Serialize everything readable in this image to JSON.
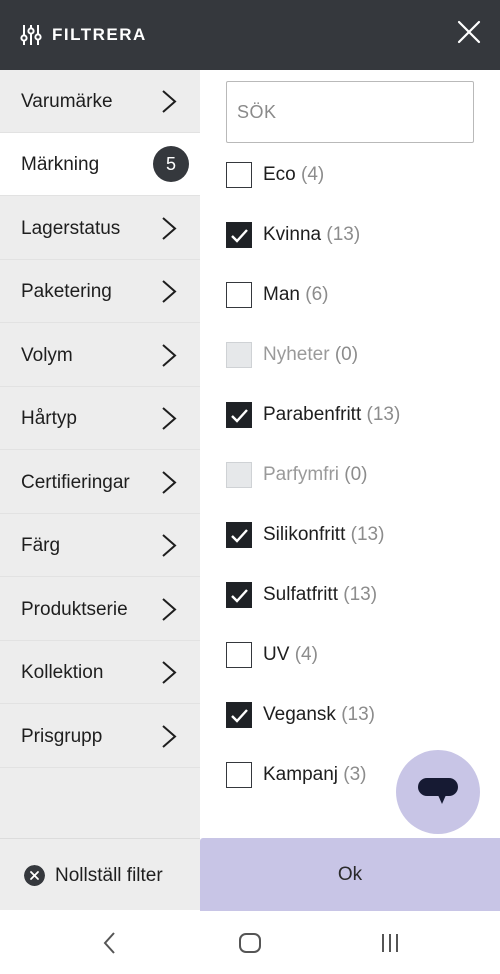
{
  "header": {
    "title": "FILTRERA",
    "filter_icon": "sliders-icon",
    "close_icon": "close-icon"
  },
  "sidebar": {
    "items": [
      {
        "label": "Varumärke"
      },
      {
        "label": "Märkning",
        "badge": "5",
        "active": true
      },
      {
        "label": "Lagerstatus"
      },
      {
        "label": "Paketering"
      },
      {
        "label": "Volym"
      },
      {
        "label": "Hårtyp"
      },
      {
        "label": "Certifieringar"
      },
      {
        "label": "Färg"
      },
      {
        "label": "Produktserie"
      },
      {
        "label": "Kollektion"
      },
      {
        "label": "Prisgrupp"
      }
    ],
    "reset_label": "Nollställ filter"
  },
  "search": {
    "placeholder": "SÖK"
  },
  "options": [
    {
      "name": "Eco",
      "count": "(4)",
      "state": "unchecked"
    },
    {
      "name": "Kvinna",
      "count": "(13)",
      "state": "checked"
    },
    {
      "name": "Man",
      "count": "(6)",
      "state": "unchecked"
    },
    {
      "name": "Nyheter",
      "count": "(0)",
      "state": "disabled"
    },
    {
      "name": "Parabenfritt",
      "count": "(13)",
      "state": "checked"
    },
    {
      "name": "Parfymfri",
      "count": "(0)",
      "state": "disabled"
    },
    {
      "name": "Silikonfritt",
      "count": "(13)",
      "state": "checked"
    },
    {
      "name": "Sulfatfritt",
      "count": "(13)",
      "state": "checked"
    },
    {
      "name": "UV",
      "count": "(4)",
      "state": "unchecked"
    },
    {
      "name": "Vegansk",
      "count": "(13)",
      "state": "checked"
    },
    {
      "name": "Kampanj",
      "count": "(3)",
      "state": "unchecked"
    }
  ],
  "ok_label": "Ok",
  "chat_icon": "chat-bubble-icon",
  "navbar": {
    "icons": [
      "back-icon",
      "home-icon",
      "recents-icon"
    ]
  },
  "colors": {
    "header": "#35383d",
    "sidebar": "#ededed",
    "accent": "#c8c5e6",
    "checked": "#1f2226"
  }
}
